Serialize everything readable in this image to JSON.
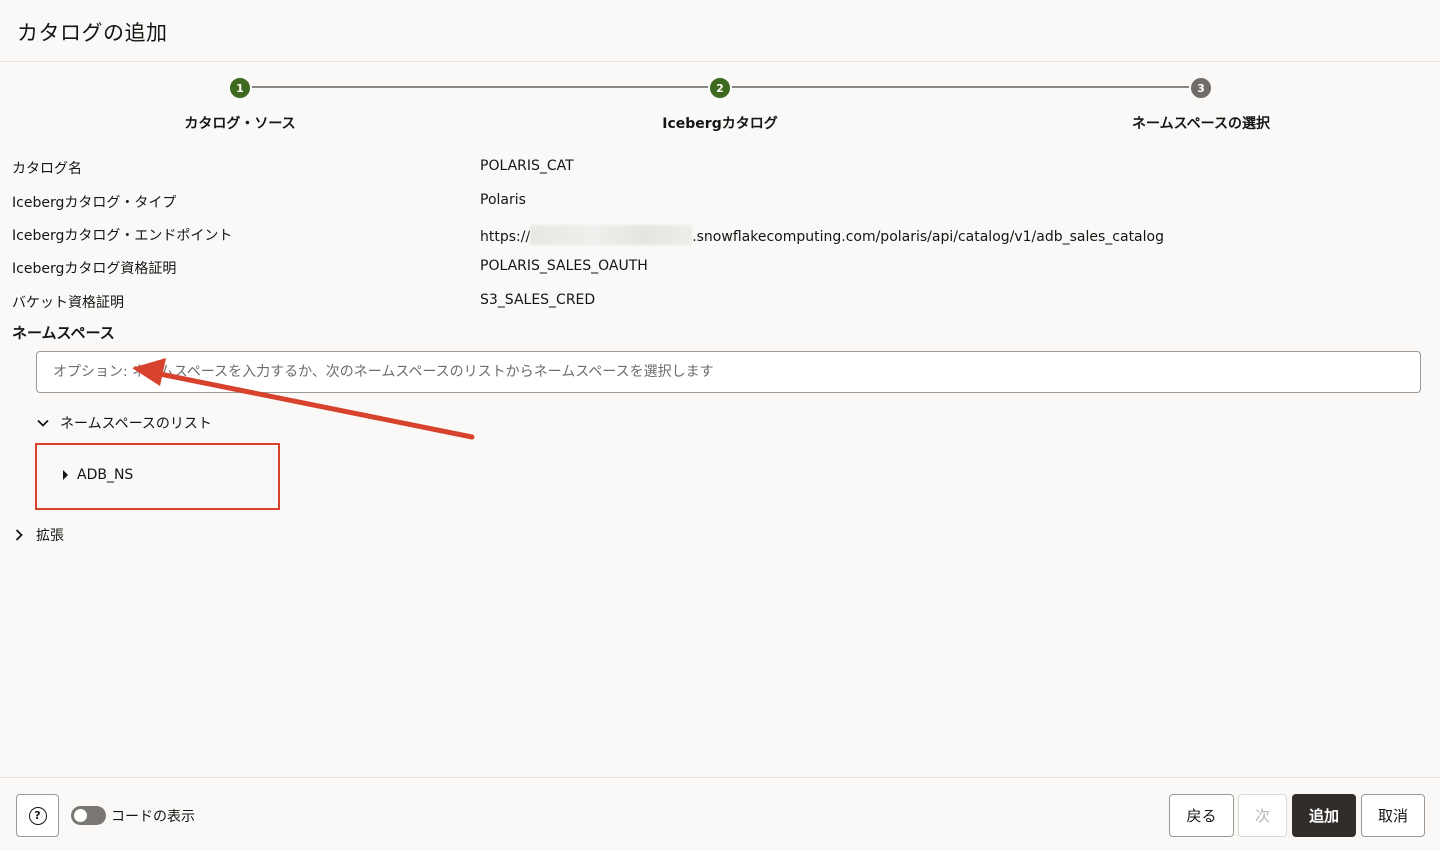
{
  "header": {
    "title": "カタログの追加"
  },
  "stepper": {
    "steps": [
      {
        "number": "1",
        "label": "カタログ・ソース"
      },
      {
        "number": "2",
        "label": "Icebergカタログ"
      },
      {
        "number": "3",
        "label": "ネームスペースの選択"
      }
    ]
  },
  "properties": [
    {
      "label": "カタログ名",
      "value": "POLARIS_CAT"
    },
    {
      "label": "Icebergカタログ・タイプ",
      "value": "Polaris"
    },
    {
      "label": "Icebergカタログ・エンドポイント",
      "value_prefix": "https://",
      "value_suffix": ".snowflakecomputing.com/polaris/api/catalog/v1/adb_sales_catalog"
    },
    {
      "label": "Icebergカタログ資格証明",
      "value": "POLARIS_SALES_OAUTH"
    },
    {
      "label": "バケット資格証明",
      "value": "S3_SALES_CRED"
    }
  ],
  "namespace": {
    "section_title": "ネームスペース",
    "placeholder": "オプション: ネームスペースを入力するか、次のネームスペースのリストからネームスペースを選択します",
    "list_label": "ネームスペースのリスト",
    "items": [
      "ADB_NS"
    ]
  },
  "advanced": {
    "label": "拡張"
  },
  "footer": {
    "help_symbol": "?",
    "show_code_label": "コードの表示",
    "back_label": "戻る",
    "next_label": "次",
    "add_label": "追加",
    "cancel_label": "取消"
  },
  "colors": {
    "step_done": "#3d6a1e",
    "step_pending": "#6f6c69",
    "highlight": "#d6422b",
    "primary_button": "#312d2a"
  }
}
